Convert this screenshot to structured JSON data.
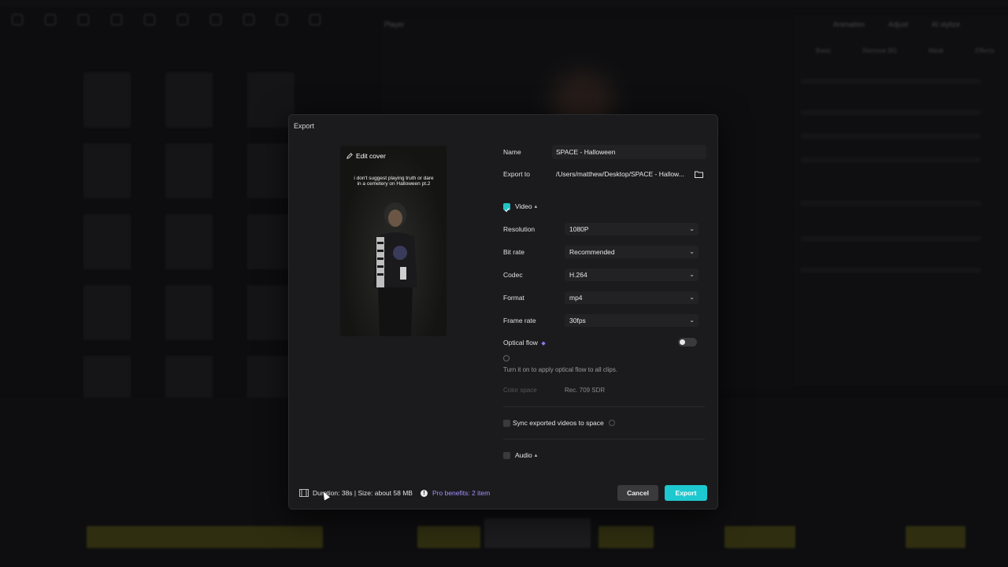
{
  "window": {
    "title": "SPACE - Halloween"
  },
  "background": {
    "player_title": "Player",
    "right_tabs": [
      "Animation",
      "Adjust",
      "AI stylize"
    ],
    "right_subtabs": [
      "Basic",
      "Remove BG",
      "Mask",
      "Effects"
    ]
  },
  "dialog": {
    "title": "Export",
    "edit_cover": "Edit cover",
    "cover_caption": "i don't suggest playing truth or dare in a cemetery on Halloween pt.2",
    "name_label": "Name",
    "name_value": "SPACE - Halloween",
    "export_to_label": "Export to",
    "export_to_value": "/Users/matthew/Desktop/SPACE - Hallow...",
    "video_section": "Video",
    "video_checked": true,
    "settings": [
      {
        "label": "Resolution",
        "value": "1080P"
      },
      {
        "label": "Bit rate",
        "value": "Recommended"
      },
      {
        "label": "Codec",
        "value": "H.264"
      },
      {
        "label": "Format",
        "value": "mp4"
      },
      {
        "label": "Frame rate",
        "value": "30fps"
      }
    ],
    "optical_flow_label": "Optical flow",
    "optical_flow_on": false,
    "optical_flow_hint": "Turn it on to apply optical flow to all clips.",
    "color_space_label": "Color space",
    "color_space_value": "Rec. 709 SDR",
    "sync_label": "Sync exported videos to space",
    "sync_checked": false,
    "audio_section": "Audio",
    "audio_checked": false,
    "footer_info": "Duration: 38s | Size: about 58 MB",
    "pro_benefits": "Pro benefits: 2 item",
    "cancel_label": "Cancel",
    "export_label": "Export"
  },
  "colors": {
    "accent": "#1ec8d0",
    "pro": "#a590ff",
    "modal_bg": "#1b1b1d"
  }
}
